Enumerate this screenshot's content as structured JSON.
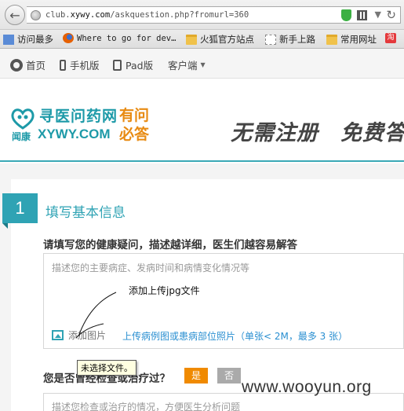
{
  "browser": {
    "url_prefix": "club.",
    "url_domain": "xywy.com",
    "url_suffix": "/askquestion.php?fromurl=360",
    "bookmarks": [
      {
        "label": "访问最多",
        "icon": "page-icon"
      },
      {
        "label": "Where to go for dev…",
        "icon": "firefox-icon"
      },
      {
        "label": "火狐官方站点",
        "icon": "folder-icon"
      },
      {
        "label": "新手上路",
        "icon": "page-icon"
      },
      {
        "label": "常用网址",
        "icon": "folder-icon"
      },
      {
        "label": "淘",
        "icon": "taobao-icon"
      }
    ]
  },
  "sitenav": {
    "items": [
      {
        "label": "首页",
        "icon": "home-icon"
      },
      {
        "label": "手机版",
        "icon": "phone-icon"
      },
      {
        "label": "Pad版",
        "icon": "tablet-icon"
      },
      {
        "label": "客户端",
        "icon": "chevron-down-icon"
      }
    ]
  },
  "header": {
    "logo_cn": "寻医问药网",
    "logo_sub_cn": "闻康",
    "logo_en": "XYWY.COM",
    "slogan_line1": "有问",
    "slogan_line2": "必答",
    "headline": "无需注册　免费答"
  },
  "form": {
    "step_number": "1",
    "step_title": "填写基本信息",
    "question_prompt": "请填写您的健康疑问，描述越详细，医生们越容易解答",
    "question_placeholder": "描述您的主要病症、发病时间和病情变化情况等",
    "annotation": "添加上传jpg文件",
    "add_image_label": "添加图片",
    "upload_hint": "上传病例图或患病部位照片（单张< 2M，最多 3 张）",
    "file_tooltip": "未选择文件。",
    "treatment_question": "您是否曾经检查或治疗过？",
    "yes_label": "是",
    "no_label": "否",
    "treatment_placeholder": "描述您检查或治疗的情况，方便医生分析问题"
  },
  "watermark": "www.wooyun.org",
  "colors": {
    "brand_teal": "#2fa3b4",
    "slogan_orange": "#e88b13",
    "link_blue": "#2a8fd1",
    "yes_orange": "#f08a00"
  }
}
